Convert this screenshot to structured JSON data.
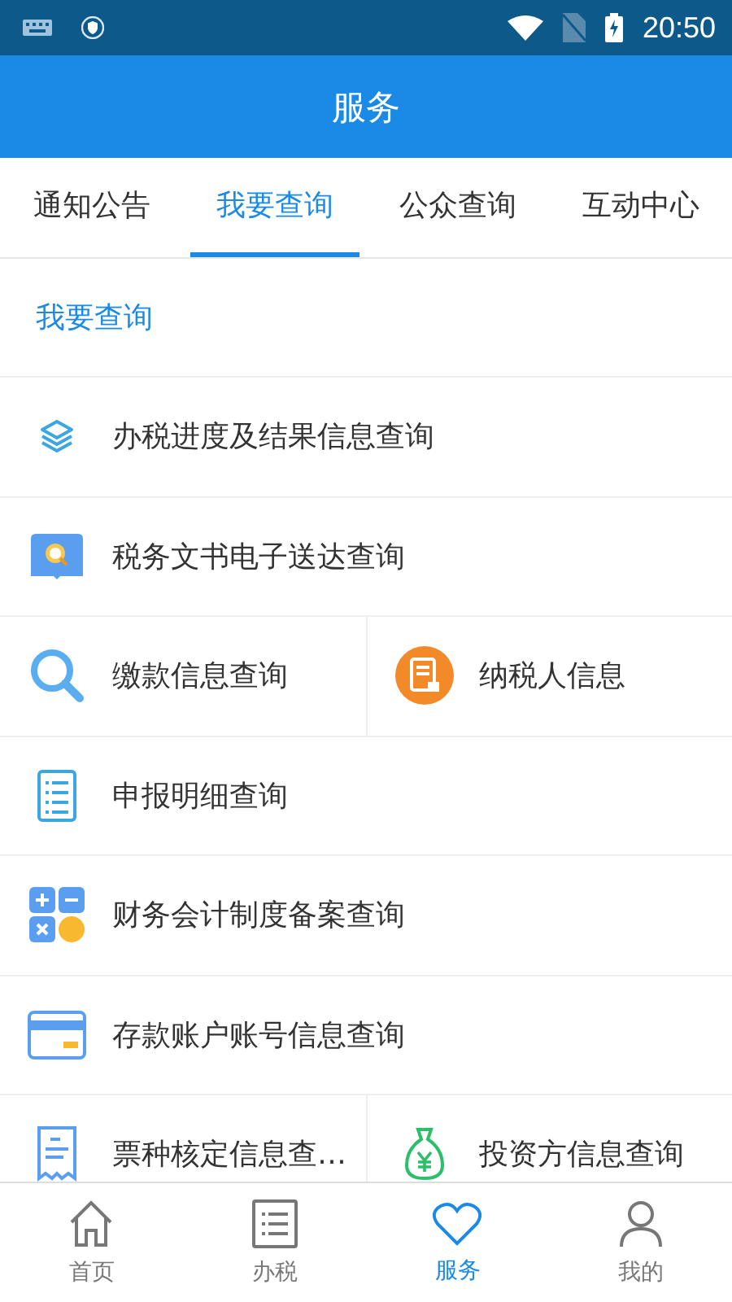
{
  "status_bar": {
    "time": "20:50"
  },
  "header": {
    "title": "服务"
  },
  "tabs": [
    {
      "label": "通知公告",
      "selected": false
    },
    {
      "label": "我要查询",
      "selected": true
    },
    {
      "label": "公众查询",
      "selected": false
    },
    {
      "label": "互动中心",
      "selected": false
    }
  ],
  "section": {
    "title": "我要查询"
  },
  "rows": [
    {
      "items": [
        {
          "label": "办税进度及结果信息查询"
        }
      ]
    },
    {
      "items": [
        {
          "label": "税务文书电子送达查询"
        }
      ]
    },
    {
      "items": [
        {
          "label": "缴款信息查询"
        },
        {
          "label": "纳税人信息"
        }
      ]
    },
    {
      "items": [
        {
          "label": "申报明细查询"
        }
      ]
    },
    {
      "items": [
        {
          "label": "财务会计制度备案查询"
        }
      ]
    },
    {
      "items": [
        {
          "label": "存款账户账号信息查询"
        }
      ]
    },
    {
      "items": [
        {
          "label": "票种核定信息查…"
        },
        {
          "label": "投资方信息查询"
        }
      ]
    }
  ],
  "bottom_nav": [
    {
      "label": "首页",
      "selected": false
    },
    {
      "label": "办税",
      "selected": false
    },
    {
      "label": "服务",
      "selected": true
    },
    {
      "label": "我的",
      "selected": false
    }
  ]
}
